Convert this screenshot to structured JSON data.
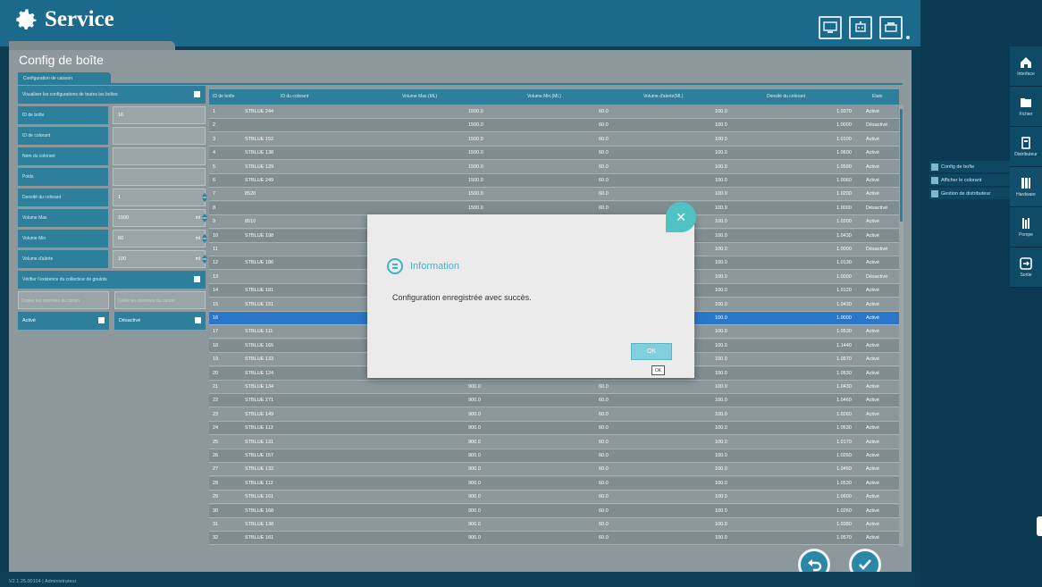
{
  "header": {
    "title": "Service",
    "icons": [
      "monitor-icon",
      "robot-icon",
      "printer-icon"
    ]
  },
  "card": {
    "title": "Config de boîte",
    "subtab": "Configuration de caisson"
  },
  "form": {
    "visualize_label": "Visualiser les configurations de toutes les boîtes",
    "fields": [
      {
        "label": "ID de boîte",
        "value": "16",
        "unit": ""
      },
      {
        "label": "ID de colorant",
        "value": "",
        "unit": ""
      },
      {
        "label": "Nom du colorant",
        "value": "",
        "unit": ""
      },
      {
        "label": "Poids",
        "value": "",
        "unit": ""
      },
      {
        "label": "Densité du colorant",
        "value": "1",
        "unit": ""
      },
      {
        "label": "Volume Max",
        "value": "1500",
        "unit": "ml"
      },
      {
        "label": "Volume Min",
        "value": "60",
        "unit": "ml"
      },
      {
        "label": "Volume d'alerte",
        "value": "100",
        "unit": "ml"
      }
    ],
    "verify_label": "Vérifier l'existence du collecteur de goulots",
    "copy_button": "Copier les données du canon",
    "paste_button": "Coller les données du canon",
    "active_select": "Activé",
    "inactive_select": "Désactivé"
  },
  "table": {
    "columns": [
      "ID de boîte",
      "ID du colorant",
      "Volume Max.(ML)",
      "Volume Min.(ML)",
      "Volume d'alerte(ML)",
      "Densité du colorant",
      "Etats"
    ],
    "rows": [
      [
        "1",
        "STBLUE 244",
        "1500.0",
        "60.0",
        "100.0",
        "1.0370",
        "Activé"
      ],
      [
        "2",
        "",
        "1500.0",
        "60.0",
        "100.0",
        "1.0000",
        "Désactivé"
      ],
      [
        "3",
        "STBLUE 152",
        "1500.0",
        "60.0",
        "100.0",
        "1.0100",
        "Activé"
      ],
      [
        "4",
        "STBLUE 138",
        "1500.0",
        "60.0",
        "100.0",
        "1.0600",
        "Activé"
      ],
      [
        "5",
        "STBLUE 129",
        "1500.0",
        "60.0",
        "100.0",
        "1.0590",
        "Activé"
      ],
      [
        "6",
        "STBLUE 249",
        "1500.0",
        "60.0",
        "100.0",
        "1.0060",
        "Activé"
      ],
      [
        "7",
        "8520",
        "1500.0",
        "60.0",
        "100.0",
        "1.0200",
        "Activé"
      ],
      [
        "8",
        "",
        "1500.0",
        "60.0",
        "100.0",
        "1.0000",
        "Désactivé"
      ],
      [
        "9",
        "8510",
        "",
        "",
        "100.0",
        "1.0200",
        "Activé"
      ],
      [
        "10",
        "STBLUE 198",
        "",
        "",
        "100.0",
        "1.0430",
        "Activé"
      ],
      [
        "11",
        "",
        "",
        "",
        "100.0",
        "1.0000",
        "Désactivé"
      ],
      [
        "12",
        "STBLUE 186",
        "",
        "",
        "100.0",
        "1.0130",
        "Activé"
      ],
      [
        "13",
        "",
        "",
        "",
        "100.0",
        "1.0000",
        "Désactivé"
      ],
      [
        "14",
        "STBLUE 181",
        "",
        "",
        "100.0",
        "1.0120",
        "Activé"
      ],
      [
        "15",
        "STBLUE 151",
        "",
        "",
        "100.0",
        "1.0430",
        "Activé"
      ],
      [
        "16",
        "",
        "",
        "",
        "100.0",
        "1.0000",
        "Activé"
      ],
      [
        "17",
        "STBLUE 111",
        "",
        "",
        "100.0",
        "1.0530",
        "Activé"
      ],
      [
        "18",
        "STBLUE 165",
        "",
        "",
        "100.0",
        "1.1440",
        "Activé"
      ],
      [
        "19",
        "STBLUE 133",
        "",
        "",
        "100.0",
        "1.0570",
        "Activé"
      ],
      [
        "20",
        "STBLUE 124",
        "",
        "",
        "100.0",
        "1.0530",
        "Activé"
      ],
      [
        "21",
        "STBLUE 134",
        "900.0",
        "60.0",
        "100.0",
        "1.0430",
        "Activé"
      ],
      [
        "22",
        "STBLUE 271",
        "900.0",
        "60.0",
        "100.0",
        "1.0460",
        "Activé"
      ],
      [
        "23",
        "STBLUE 149",
        "900.0",
        "60.0",
        "100.0",
        "1.0260",
        "Activé"
      ],
      [
        "24",
        "STBLUE 113",
        "900.0",
        "60.0",
        "100.0",
        "1.0630",
        "Activé"
      ],
      [
        "25",
        "STBLUE 131",
        "900.0",
        "60.0",
        "100.0",
        "1.0170",
        "Activé"
      ],
      [
        "26",
        "STBLUE 157",
        "900.0",
        "60.0",
        "100.0",
        "1.0260",
        "Activé"
      ],
      [
        "27",
        "STBLUE 132",
        "900.0",
        "60.0",
        "100.0",
        "1.0450",
        "Activé"
      ],
      [
        "28",
        "STBLUE 112",
        "900.0",
        "60.0",
        "100.0",
        "1.0530",
        "Activé"
      ],
      [
        "29",
        "STBLUE 161",
        "900.0",
        "60.0",
        "100.0",
        "1.0600",
        "Activé"
      ],
      [
        "30",
        "STBLUE 168",
        "900.0",
        "60.0",
        "100.0",
        "1.0260",
        "Activé"
      ],
      [
        "31",
        "STBLUE 138",
        "900.0",
        "60.0",
        "100.0",
        "1.0380",
        "Activé"
      ],
      [
        "32",
        "STBLUE 161",
        "900.0",
        "60.0",
        "100.0",
        "1.0570",
        "Activé"
      ]
    ],
    "selected_row": "16"
  },
  "dialog": {
    "title": "Information",
    "message": "Configuration enregistrée avec succès.",
    "ok_label": "OK",
    "ok_tooltip": "OK"
  },
  "side_nav": [
    {
      "label": "Interface",
      "icon": "home-icon"
    },
    {
      "label": "Fichier",
      "icon": "folder-icon"
    },
    {
      "label": "Distributeur",
      "icon": "dispenser-icon"
    },
    {
      "label": "Hardware",
      "icon": "hardware-icon"
    },
    {
      "label": "Pompe",
      "icon": "pump-icon"
    },
    {
      "label": "Sortie",
      "icon": "exit-icon"
    }
  ],
  "submenu": [
    "Config de boîte",
    "Afficher le colorant",
    "Gestion de distributeur"
  ],
  "footer": {
    "version": "V2.1.25.00104  |  Administrateur"
  },
  "colors": {
    "primary": "#1c6a8b",
    "panel": "#8c989b",
    "selected_row": "#2a77c9",
    "dialog_accent": "#3fb3c2"
  }
}
